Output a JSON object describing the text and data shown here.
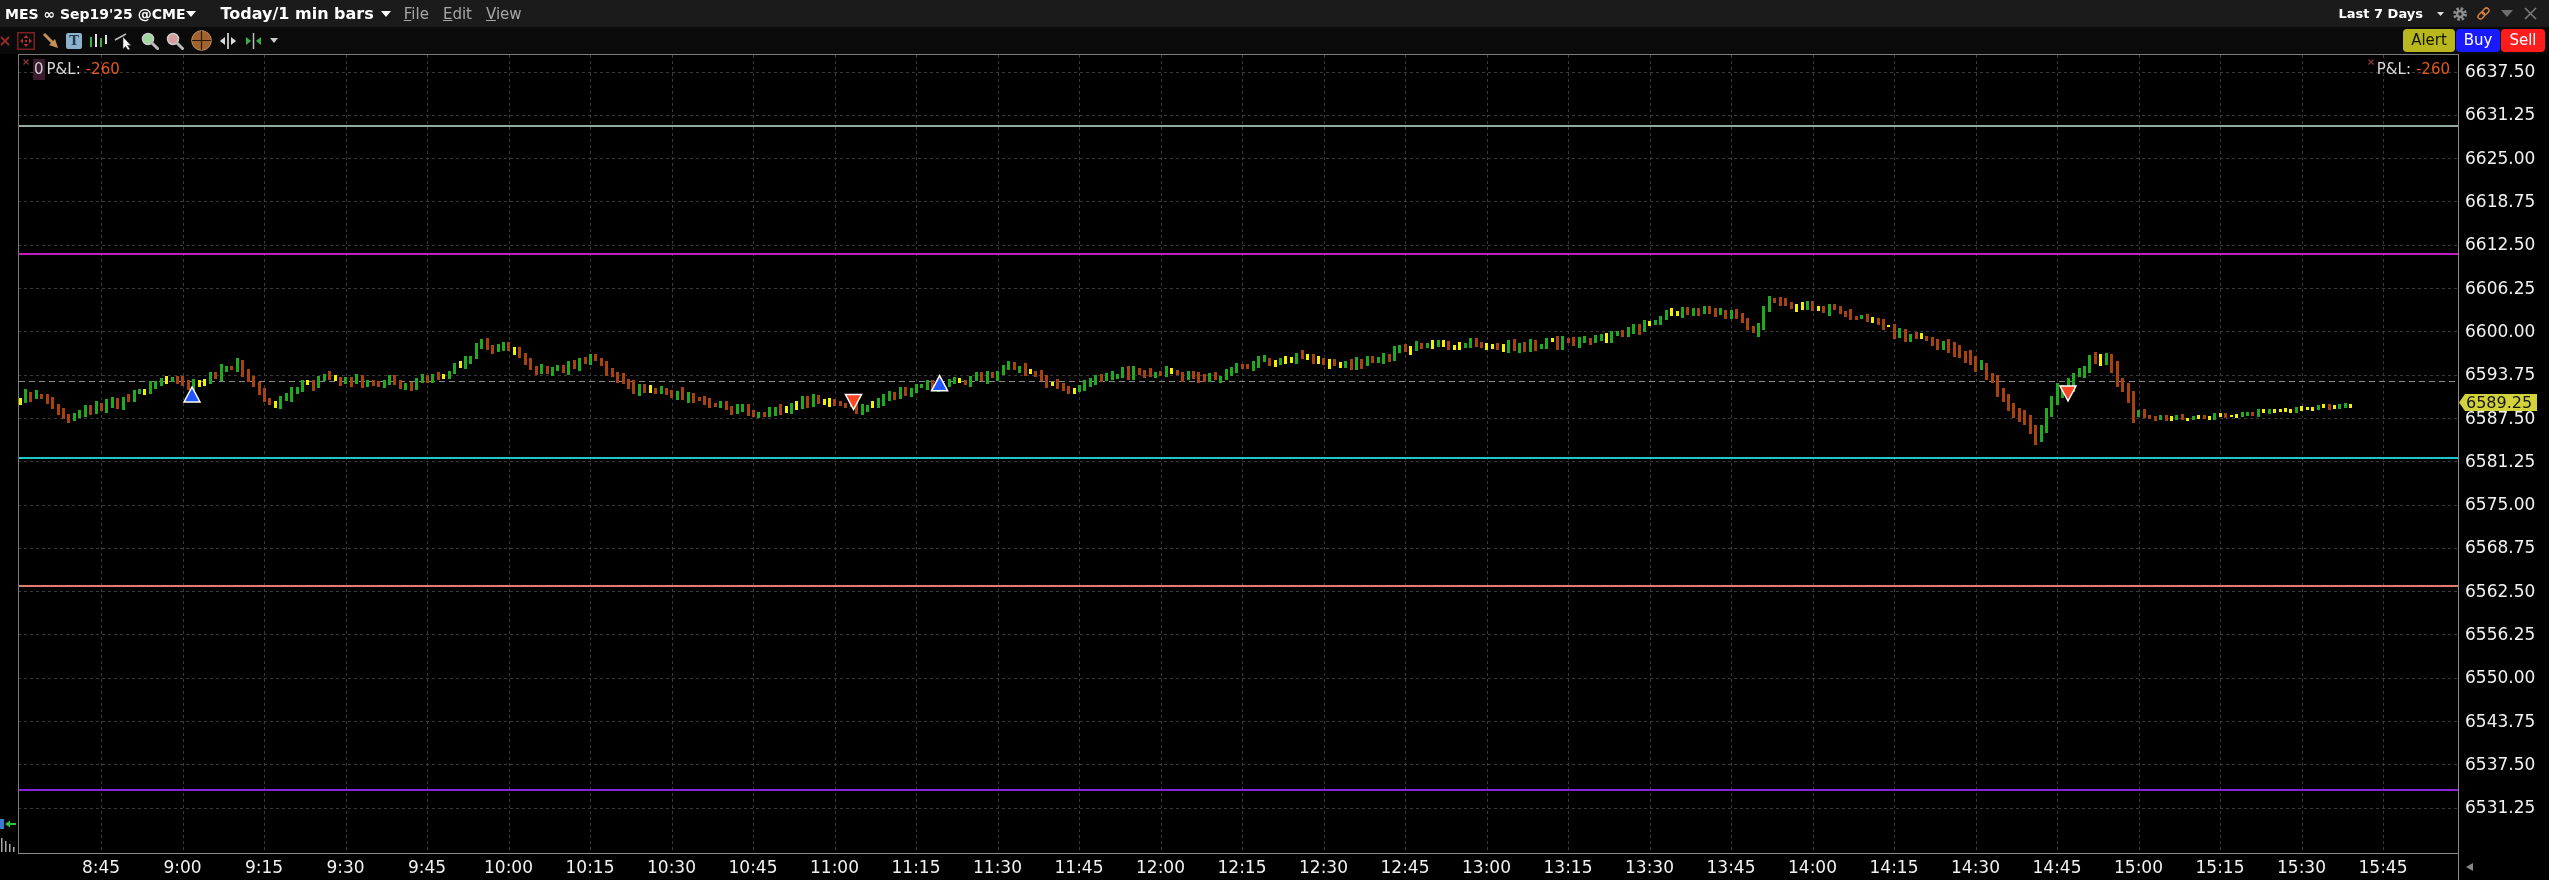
{
  "title_bar": {
    "instrument": "MES ∞ Sep19'25 @CME",
    "period": "Today/1 min bars",
    "menu": [
      "File",
      "Edit",
      "View"
    ],
    "range": "Last 7 Days"
  },
  "toolbar": {
    "text_tool": "T"
  },
  "order_buttons": [
    {
      "kind": "alert",
      "label": "Alert"
    },
    {
      "kind": "buy",
      "label": "Buy"
    },
    {
      "kind": "sell",
      "label": "Sell"
    }
  ],
  "chart": {
    "pnl_left": {
      "count": "0",
      "label": "P&L:",
      "value": "-260"
    },
    "pnl_right": {
      "label": "P&L:",
      "value": "-260"
    },
    "price_axis": [
      "6637.50",
      "6631.25",
      "6625.00",
      "6618.75",
      "6612.50",
      "6606.25",
      "6600.00",
      "6593.75",
      "6587.50",
      "6581.25",
      "6575.00",
      "6568.75",
      "6562.50",
      "6556.25",
      "6550.00",
      "6543.75",
      "6537.50",
      "6531.25"
    ],
    "last_price": "6589.25",
    "time_axis": [
      "8:45",
      "9:00",
      "9:15",
      "9:30",
      "9:45",
      "10:00",
      "10:15",
      "10:30",
      "10:45",
      "11:00",
      "11:15",
      "11:30",
      "11:45",
      "12:00",
      "12:15",
      "12:30",
      "12:45",
      "13:00",
      "13:15",
      "13:30",
      "13:45",
      "14:00",
      "14:15",
      "14:30",
      "14:45",
      "15:00",
      "15:15",
      "15:30",
      "15:45"
    ],
    "levels": [
      {
        "color": "#93aa9e"
      },
      {
        "color": "#c01cc0"
      },
      {
        "color": "#1fc6c6"
      },
      {
        "color": "#e27a72"
      },
      {
        "color": "#8a22d8"
      }
    ],
    "markers": [
      {
        "kind": "buy"
      },
      {
        "kind": "sell"
      },
      {
        "kind": "buy"
      },
      {
        "kind": "sell"
      }
    ]
  }
}
